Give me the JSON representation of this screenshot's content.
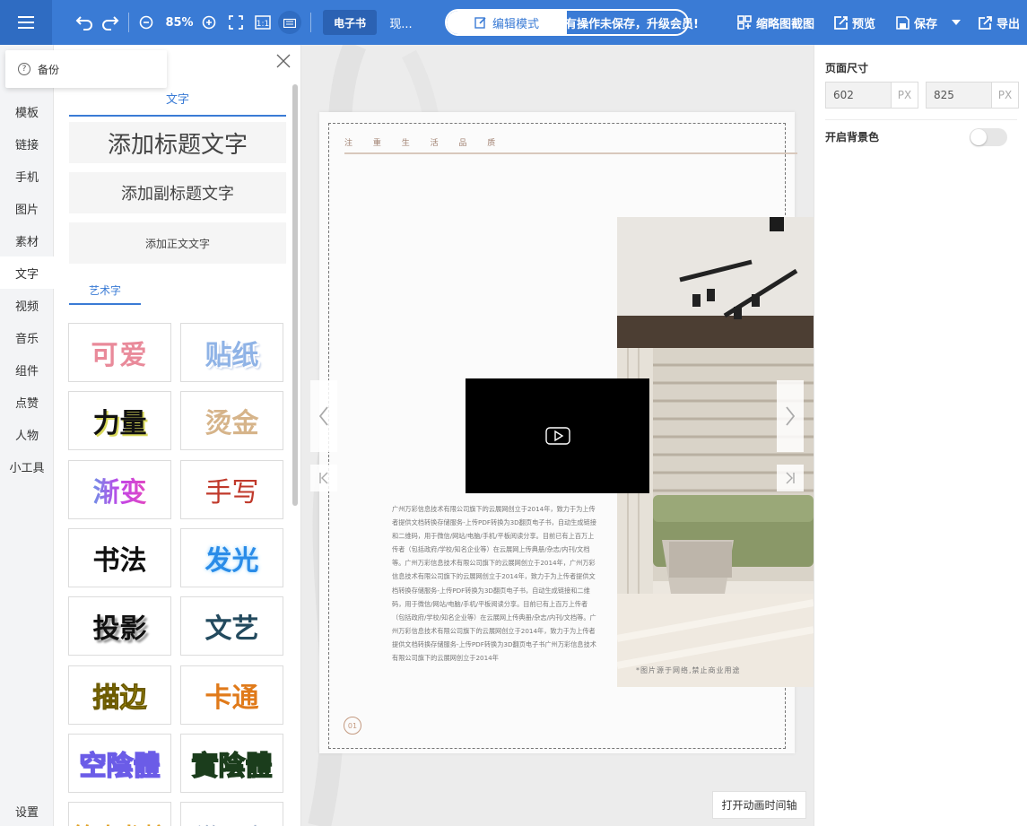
{
  "topbar": {
    "zoom": "85%",
    "ebook_tab": "电子书",
    "second_tab": "现...",
    "mode_on": "编辑模式",
    "mode_off": "模式",
    "marquee": "有操作未保存，升级会员!",
    "thumb_crop": "缩略图截图",
    "preview": "预览",
    "save": "保存",
    "export": "导出"
  },
  "leftnav": {
    "backup": "备份",
    "items": [
      "模板",
      "链接",
      "手机",
      "图片",
      "素材",
      "文字",
      "视频",
      "音乐",
      "组件",
      "点赞",
      "人物",
      "小工具"
    ],
    "active_index": 5,
    "settings": "设置"
  },
  "panel": {
    "tab_text": "文字",
    "add_title": "添加标题文字",
    "add_subtitle": "添加副标题文字",
    "add_body": "添加正文文字",
    "tab_art": "艺术字",
    "art": [
      "可爱",
      "贴纸",
      "力量",
      "烫金",
      "渐变",
      "手写",
      "书法",
      "发光",
      "投影",
      "文艺",
      "描边",
      "卡通",
      "空陰體",
      "實陰體",
      "笔走龙蛇",
      "激万水"
    ]
  },
  "page": {
    "brand": "注 重 生 活 品 质",
    "body": "广州万彩信息技术有限公司旗下的云展网创立于2014年，致力于为上传者提供文档转换存储服务-上传PDF转换为3D翻页电子书，自动生成链接和二维码，用于微信/网站/电脑/手机/平板阅读分享。目前已有上百万上传者（包括政府/学校/知名企业等）在云展网上传典册/杂志/内刊/文档等。广州万彩信息技术有限公司旗下的云展网创立于2014年，广州万彩信息技术有限公司旗下的云展网创立于2014年，致力于为上传者提供文档转换存储服务-上传PDF转换为3D翻页电子书，自动生成链接和二维码，用于微信/网站/电脑/手机/平板阅读分享。目前已有上百万上传者（包括政府/学校/知名企业等）在云展网上传典册/杂志/内刊/文档等。广州万彩信息技术有限公司旗下的云展网创立于2014年，致力于为上传者提供文档转换存储服务-上传PDF转换为3D翻页电子书广州万彩信息技术有限公司旗下的云展网创立于2014年",
    "caption": "*图片源于网络,禁止商业用途",
    "page_number": "01",
    "timeline_button": "打开动画时间轴"
  },
  "right": {
    "page_size_label": "页面尺寸",
    "width": "602",
    "height": "825",
    "unit": "PX",
    "bg_toggle_label": "开启背景色",
    "bg_toggle_on": false
  }
}
